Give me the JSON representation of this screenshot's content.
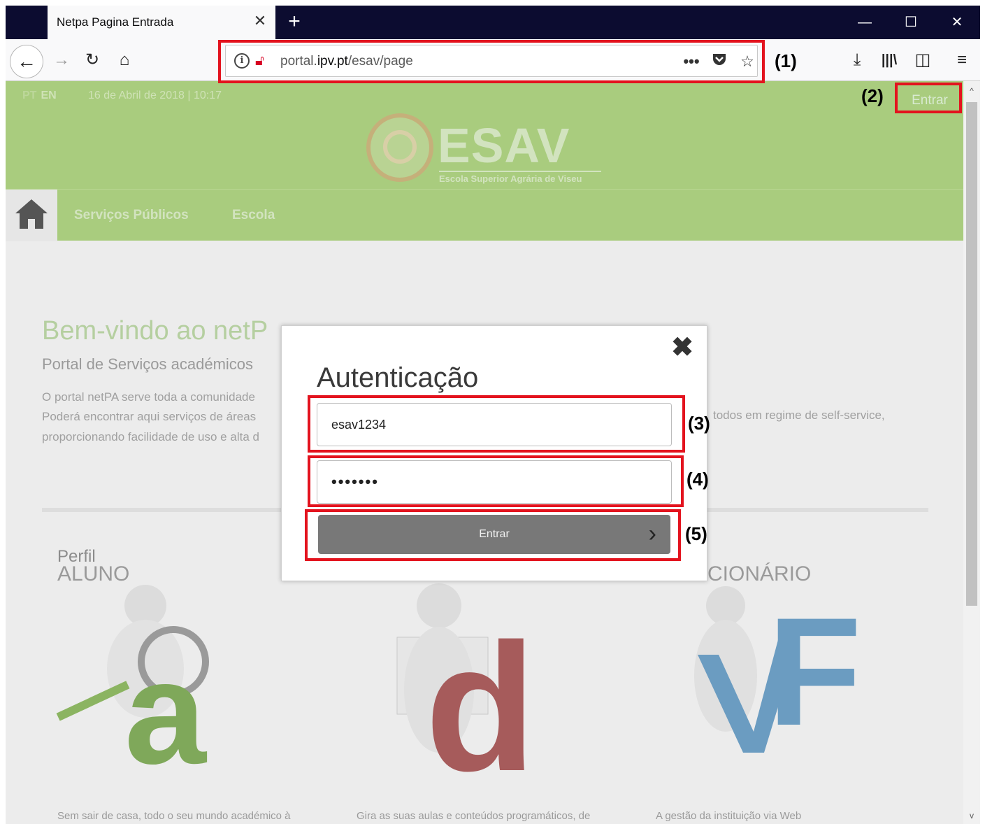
{
  "browser": {
    "tab_title": "Netpa Pagina Entrada",
    "tab_close": "✕",
    "new_tab": "+",
    "url_prefix": "portal.",
    "url_host": "ipv.pt",
    "url_path": "/esav/page",
    "page_actions": "•••"
  },
  "annotations": {
    "label_1": "(1)",
    "label_2": "(2)",
    "label_3": "(3)",
    "label_4": "(4)",
    "label_5": "(5)",
    "box_color": "#e3131e"
  },
  "page": {
    "lang_pt": "PT",
    "lang_en": "EN",
    "datetime": "16 de Abril de 2018 | 10:17",
    "enter_button": "Entrar",
    "logo_title": "ESAV",
    "logo_subtitle": "Escola Superior Agrária de Viseu",
    "menu": {
      "item_1": "Serviços Públicos",
      "item_2": "Escola"
    },
    "welcome_title": "Bem-vindo ao netP",
    "welcome_subtitle": "Portal de Serviços académicos",
    "para_line_1": "O portal netPA serve toda a comunidade",
    "para_line_2": "Poderá encontrar aqui serviços de áreas",
    "para_line_3": "proporcionando facilidade de uso e alta d",
    "para_right": "todos em regime de self-service,",
    "perfil": "Perfil",
    "aluno": "ALUNO",
    "funcionario_partial": "CIONÁRIO",
    "caption_1": "Sem sair de casa, todo o seu mundo académico à",
    "caption_2": "Gira as suas aulas e conteúdos programáticos, de",
    "caption_3": "A gestão da instituição via Web",
    "colors": {
      "header_green": "#a9cc7e",
      "letter_a": "#7fa85a",
      "letter_d": "#a65b5b",
      "letter_f": "#6b9cc1"
    }
  },
  "modal": {
    "title": "Autenticação",
    "close_icon": "✖",
    "username_value": "esav1234",
    "password_value": "•••••••",
    "submit_label": "Entrar",
    "submit_chevron": "›"
  }
}
